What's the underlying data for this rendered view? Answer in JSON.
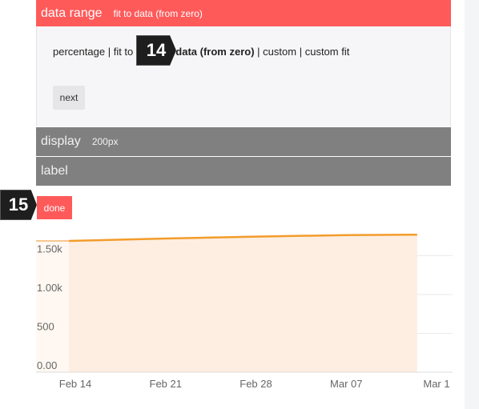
{
  "data_range": {
    "title": "data range",
    "current_value": "fit to data (from zero)",
    "options": [
      "percentage",
      "fit to data",
      "fit to data (from zero)",
      "custom",
      "custom fit"
    ],
    "visible_options": [
      "percentage",
      "fit to",
      "fit to data (from zero)",
      "custom",
      "custom fit"
    ],
    "selected_option": "fit to data (from zero)",
    "separator": "|",
    "next_label": "next"
  },
  "display": {
    "title": "display",
    "value": "200px"
  },
  "label": {
    "title": "label"
  },
  "done_label": "done",
  "badges": {
    "step_14": "14",
    "step_15": "15"
  },
  "colors": {
    "accent_red": "#ff5a5a",
    "bar_grey": "#808080",
    "panel_bg": "#f6f6f8",
    "line_orange": "#f39c2b",
    "area_fill": "#fdeee1",
    "badge_bg": "#1e1e1e"
  },
  "chart_data": {
    "type": "area",
    "title": "",
    "xlabel": "",
    "ylabel": "",
    "x": [
      "2024-02-14",
      "2024-02-21",
      "2024-02-28",
      "2024-03-07",
      "2024-03-11"
    ],
    "values": [
      1690,
      1720,
      1745,
      1765,
      1770
    ],
    "ylim": [
      0,
      1700
    ],
    "y_ticks": [
      "0.00",
      "500",
      "1.00k",
      "1.50k"
    ],
    "y_tick_values": [
      0,
      500,
      1000,
      1500
    ],
    "x_ticks": [
      "Feb 14",
      "Feb 21",
      "Feb 28",
      "Mar 07",
      "Mar 1"
    ],
    "x_tick_positions_days": [
      0,
      7,
      14,
      21,
      28
    ],
    "data_x_days": [
      0,
      7,
      14,
      21,
      26.5
    ],
    "grid": true
  }
}
